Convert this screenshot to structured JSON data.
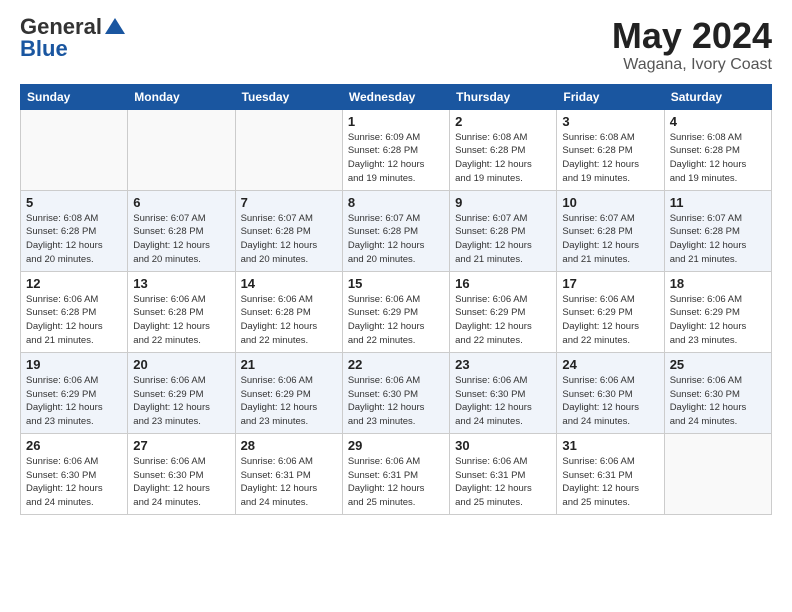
{
  "header": {
    "logo_general": "General",
    "logo_blue": "Blue",
    "title": "May 2024",
    "location": "Wagana, Ivory Coast"
  },
  "weekdays": [
    "Sunday",
    "Monday",
    "Tuesday",
    "Wednesday",
    "Thursday",
    "Friday",
    "Saturday"
  ],
  "weeks": [
    [
      {
        "day": "",
        "info": ""
      },
      {
        "day": "",
        "info": ""
      },
      {
        "day": "",
        "info": ""
      },
      {
        "day": "1",
        "info": "Sunrise: 6:09 AM\nSunset: 6:28 PM\nDaylight: 12 hours\nand 19 minutes."
      },
      {
        "day": "2",
        "info": "Sunrise: 6:08 AM\nSunset: 6:28 PM\nDaylight: 12 hours\nand 19 minutes."
      },
      {
        "day": "3",
        "info": "Sunrise: 6:08 AM\nSunset: 6:28 PM\nDaylight: 12 hours\nand 19 minutes."
      },
      {
        "day": "4",
        "info": "Sunrise: 6:08 AM\nSunset: 6:28 PM\nDaylight: 12 hours\nand 19 minutes."
      }
    ],
    [
      {
        "day": "5",
        "info": "Sunrise: 6:08 AM\nSunset: 6:28 PM\nDaylight: 12 hours\nand 20 minutes."
      },
      {
        "day": "6",
        "info": "Sunrise: 6:07 AM\nSunset: 6:28 PM\nDaylight: 12 hours\nand 20 minutes."
      },
      {
        "day": "7",
        "info": "Sunrise: 6:07 AM\nSunset: 6:28 PM\nDaylight: 12 hours\nand 20 minutes."
      },
      {
        "day": "8",
        "info": "Sunrise: 6:07 AM\nSunset: 6:28 PM\nDaylight: 12 hours\nand 20 minutes."
      },
      {
        "day": "9",
        "info": "Sunrise: 6:07 AM\nSunset: 6:28 PM\nDaylight: 12 hours\nand 21 minutes."
      },
      {
        "day": "10",
        "info": "Sunrise: 6:07 AM\nSunset: 6:28 PM\nDaylight: 12 hours\nand 21 minutes."
      },
      {
        "day": "11",
        "info": "Sunrise: 6:07 AM\nSunset: 6:28 PM\nDaylight: 12 hours\nand 21 minutes."
      }
    ],
    [
      {
        "day": "12",
        "info": "Sunrise: 6:06 AM\nSunset: 6:28 PM\nDaylight: 12 hours\nand 21 minutes."
      },
      {
        "day": "13",
        "info": "Sunrise: 6:06 AM\nSunset: 6:28 PM\nDaylight: 12 hours\nand 22 minutes."
      },
      {
        "day": "14",
        "info": "Sunrise: 6:06 AM\nSunset: 6:28 PM\nDaylight: 12 hours\nand 22 minutes."
      },
      {
        "day": "15",
        "info": "Sunrise: 6:06 AM\nSunset: 6:29 PM\nDaylight: 12 hours\nand 22 minutes."
      },
      {
        "day": "16",
        "info": "Sunrise: 6:06 AM\nSunset: 6:29 PM\nDaylight: 12 hours\nand 22 minutes."
      },
      {
        "day": "17",
        "info": "Sunrise: 6:06 AM\nSunset: 6:29 PM\nDaylight: 12 hours\nand 22 minutes."
      },
      {
        "day": "18",
        "info": "Sunrise: 6:06 AM\nSunset: 6:29 PM\nDaylight: 12 hours\nand 23 minutes."
      }
    ],
    [
      {
        "day": "19",
        "info": "Sunrise: 6:06 AM\nSunset: 6:29 PM\nDaylight: 12 hours\nand 23 minutes."
      },
      {
        "day": "20",
        "info": "Sunrise: 6:06 AM\nSunset: 6:29 PM\nDaylight: 12 hours\nand 23 minutes."
      },
      {
        "day": "21",
        "info": "Sunrise: 6:06 AM\nSunset: 6:29 PM\nDaylight: 12 hours\nand 23 minutes."
      },
      {
        "day": "22",
        "info": "Sunrise: 6:06 AM\nSunset: 6:30 PM\nDaylight: 12 hours\nand 23 minutes."
      },
      {
        "day": "23",
        "info": "Sunrise: 6:06 AM\nSunset: 6:30 PM\nDaylight: 12 hours\nand 24 minutes."
      },
      {
        "day": "24",
        "info": "Sunrise: 6:06 AM\nSunset: 6:30 PM\nDaylight: 12 hours\nand 24 minutes."
      },
      {
        "day": "25",
        "info": "Sunrise: 6:06 AM\nSunset: 6:30 PM\nDaylight: 12 hours\nand 24 minutes."
      }
    ],
    [
      {
        "day": "26",
        "info": "Sunrise: 6:06 AM\nSunset: 6:30 PM\nDaylight: 12 hours\nand 24 minutes."
      },
      {
        "day": "27",
        "info": "Sunrise: 6:06 AM\nSunset: 6:30 PM\nDaylight: 12 hours\nand 24 minutes."
      },
      {
        "day": "28",
        "info": "Sunrise: 6:06 AM\nSunset: 6:31 PM\nDaylight: 12 hours\nand 24 minutes."
      },
      {
        "day": "29",
        "info": "Sunrise: 6:06 AM\nSunset: 6:31 PM\nDaylight: 12 hours\nand 25 minutes."
      },
      {
        "day": "30",
        "info": "Sunrise: 6:06 AM\nSunset: 6:31 PM\nDaylight: 12 hours\nand 25 minutes."
      },
      {
        "day": "31",
        "info": "Sunrise: 6:06 AM\nSunset: 6:31 PM\nDaylight: 12 hours\nand 25 minutes."
      },
      {
        "day": "",
        "info": ""
      }
    ]
  ]
}
